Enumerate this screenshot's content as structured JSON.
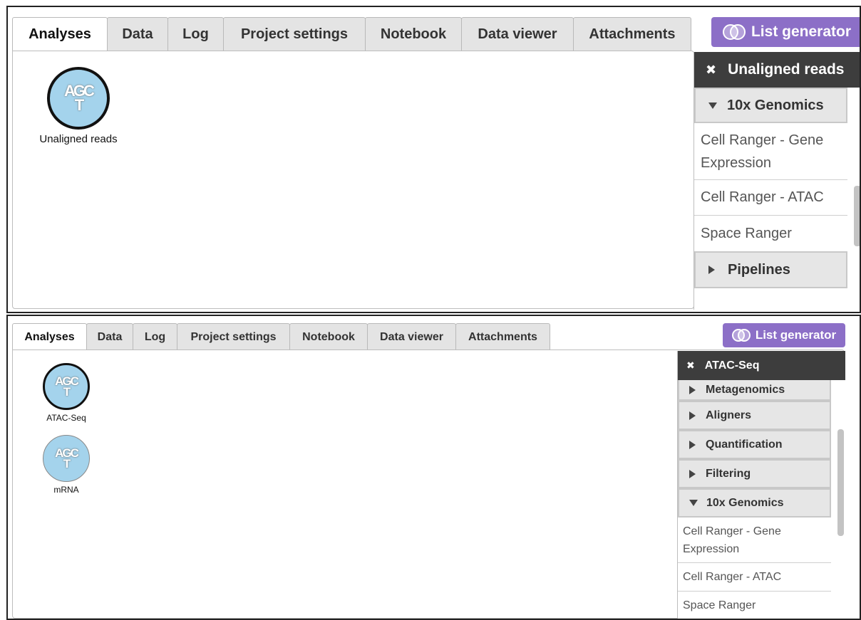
{
  "top": {
    "tabs": [
      "Analyses",
      "Data",
      "Log",
      "Project settings",
      "Notebook",
      "Data viewer",
      "Attachments"
    ],
    "list_generator": "List generator",
    "node_label": "Unaligned reads",
    "node_glyph": "AGCT",
    "panel": {
      "header": "Unaligned reads",
      "close": "✖",
      "groups": [
        {
          "label": "10x Genomics",
          "expanded": true
        },
        {
          "label": "Pipelines",
          "expanded": false
        }
      ],
      "items": [
        "Cell Ranger - Gene Expression",
        "Cell Ranger - ATAC",
        "Space Ranger"
      ]
    }
  },
  "bottom": {
    "tabs": [
      "Analyses",
      "Data",
      "Log",
      "Project settings",
      "Notebook",
      "Data viewer",
      "Attachments"
    ],
    "list_generator": "List generator",
    "nodes": [
      {
        "label": "ATAC-Seq",
        "glyph": "AGCT"
      },
      {
        "label": "mRNA",
        "glyph": "AGCT"
      }
    ],
    "panel": {
      "header": "ATAC-Seq",
      "close": "✖",
      "groups": [
        {
          "label": "Metagenomics",
          "expanded": false
        },
        {
          "label": "Aligners",
          "expanded": false
        },
        {
          "label": "Quantification",
          "expanded": false
        },
        {
          "label": "Filtering",
          "expanded": false
        },
        {
          "label": "10x Genomics",
          "expanded": true
        }
      ],
      "items": [
        "Cell Ranger - Gene Expression",
        "Cell Ranger - ATAC",
        "Space Ranger"
      ]
    }
  },
  "colors": {
    "accent": "#8c6fc7",
    "panel_header": "#3d3d3d",
    "node_fill": "#a4d3ec"
  },
  "icons": {
    "close": "close-icon",
    "expanded": "triangle-down-icon",
    "collapsed": "triangle-right-icon",
    "list_generator": "venn-icon",
    "node": "dna-bases-icon"
  }
}
